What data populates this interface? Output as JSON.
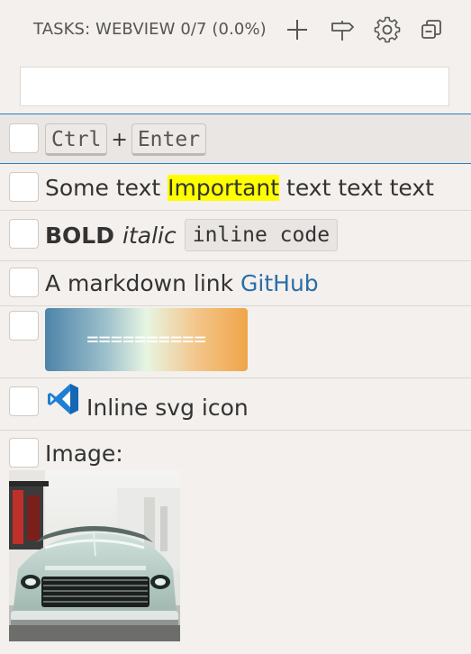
{
  "header": {
    "title": "TASKS: WEBVIEW 0/7 (0.0%)",
    "actions": [
      {
        "name": "add-task",
        "icon": "plus-icon"
      },
      {
        "name": "filter-signpost",
        "icon": "signpost-icon"
      },
      {
        "name": "settings",
        "icon": "gear-icon"
      },
      {
        "name": "collapse-all",
        "icon": "collapse-icon"
      }
    ]
  },
  "filter": {
    "value": "",
    "placeholder": ""
  },
  "tasks": [
    {
      "keys": [
        "Ctrl",
        "Enter"
      ],
      "separator": "+"
    },
    {
      "before": "Some text ",
      "highlight": "Important",
      "after": " text text text"
    },
    {
      "bold": "BOLD",
      "italic": "italic",
      "code": "inline code"
    },
    {
      "text": "A markdown link ",
      "link": "GitHub"
    },
    {
      "gradient_text": "=========="
    },
    {
      "icon": "vscode-icon",
      "text": "Inline svg icon"
    },
    {
      "label": "Image:"
    }
  ],
  "colors": {
    "accent": "#2c7fbf",
    "highlight": "#ffff00",
    "link": "#2b6ea8",
    "vscode_blue": "#1f7fd4"
  }
}
